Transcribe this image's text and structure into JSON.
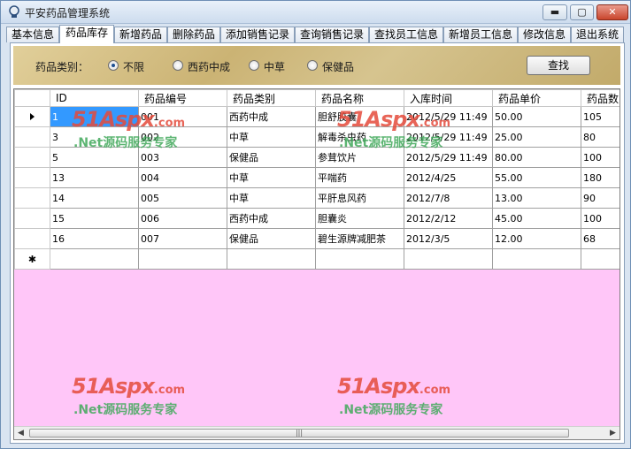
{
  "window": {
    "title": "平安药品管理系统",
    "min_label": "▬",
    "max_label": "▢",
    "close_label": "✕"
  },
  "tabs": [
    {
      "label": "基本信息"
    },
    {
      "label": "药品库存"
    },
    {
      "label": "新增药品"
    },
    {
      "label": "删除药品"
    },
    {
      "label": "添加销售记录"
    },
    {
      "label": "查询销售记录"
    },
    {
      "label": "查找员工信息"
    },
    {
      "label": "新增员工信息"
    },
    {
      "label": "修改信息"
    },
    {
      "label": "退出系统"
    }
  ],
  "active_tab": "药品库存",
  "filter": {
    "label": "药品类别：",
    "options": [
      {
        "label": "不限",
        "checked": true
      },
      {
        "label": "西药中成",
        "checked": false
      },
      {
        "label": "中草",
        "checked": false
      },
      {
        "label": "保健品",
        "checked": false
      }
    ],
    "search_button": "查找"
  },
  "grid": {
    "columns": [
      "ID",
      "药品编号",
      "药品类别",
      "药品名称",
      "入库时间",
      "药品单价",
      "药品数"
    ],
    "rows": [
      [
        "1",
        "001",
        "西药中成",
        "胆舒胶囊",
        "2012/5/29 11:49",
        "50.00",
        "105"
      ],
      [
        "3",
        "002",
        "中草",
        "解毒杀虫药",
        "2012/5/29 11:49",
        "25.00",
        "80"
      ],
      [
        "5",
        "003",
        "保健品",
        "参茸饮片",
        "2012/5/29 11:49",
        "80.00",
        "100"
      ],
      [
        "13",
        "004",
        "中草",
        "平喘药",
        "2012/4/25",
        "55.00",
        "180"
      ],
      [
        "14",
        "005",
        "中草",
        "平肝息风药",
        "2012/7/8",
        "13.00",
        "90"
      ],
      [
        "15",
        "006",
        "西药中成",
        "胆囊炎",
        "2012/2/12",
        "45.00",
        "100"
      ],
      [
        "16",
        "007",
        "保健品",
        "碧生源牌减肥茶",
        "2012/3/5",
        "12.00",
        "68"
      ]
    ],
    "new_row_marker": "✱",
    "scroll_grip": "|||"
  },
  "watermark": {
    "logo": "51Aspx",
    "domain": ".com",
    "tagline": ".Net源码服务专家"
  },
  "colors": {
    "grid_background": "#ffc6f8",
    "selection": "#3399ff",
    "watermark_red": "#e54b3c",
    "watermark_green": "#41a95b"
  }
}
